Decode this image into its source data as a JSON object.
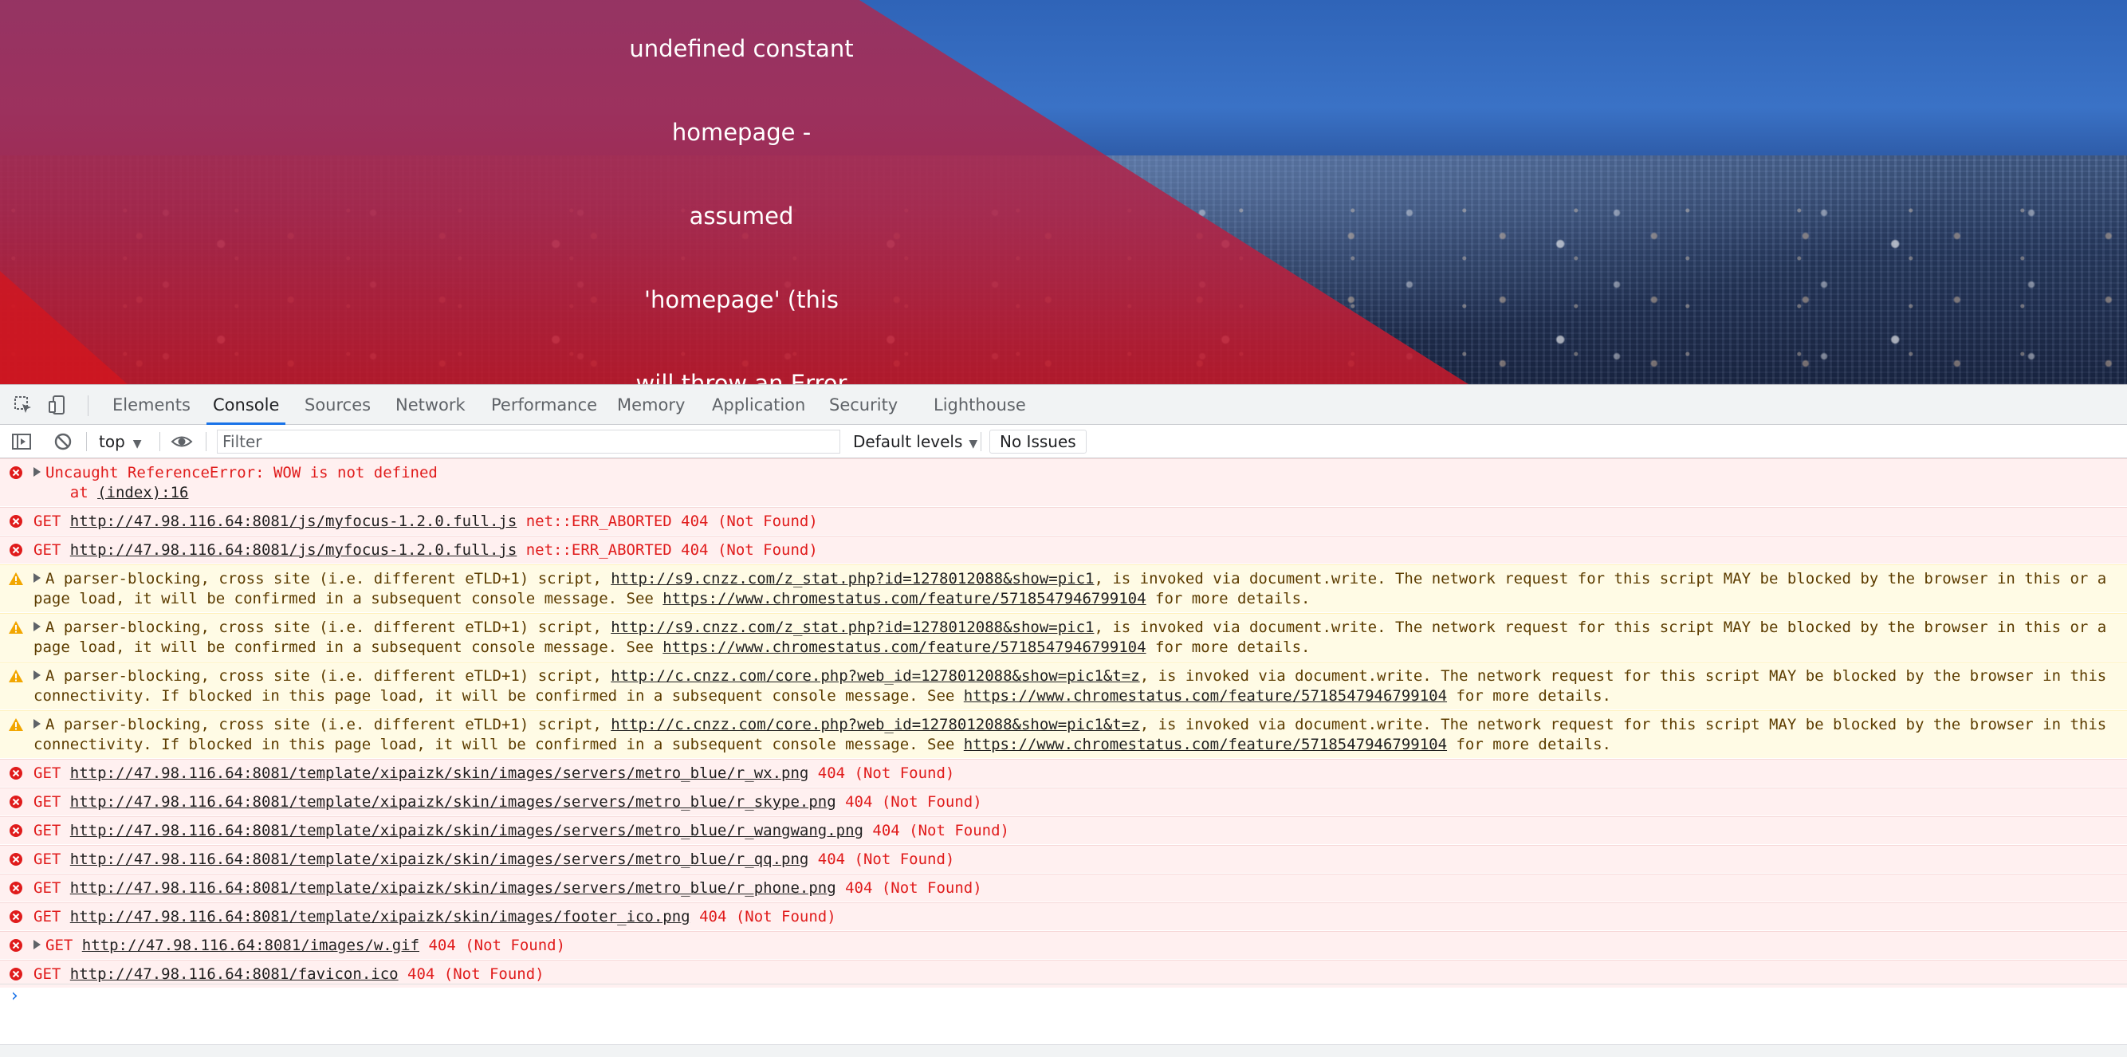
{
  "page": {
    "heading_lines": [
      "undefined constant",
      "homepage -",
      "assumed",
      "'homepage' (this",
      "will throw an Error"
    ]
  },
  "devtools": {
    "tabs": [
      "Elements",
      "Console",
      "Sources",
      "Network",
      "Performance",
      "Memory",
      "Application",
      "Security",
      "Lighthouse"
    ],
    "active_tab": "Console",
    "toolbar": {
      "context": "top",
      "filter_placeholder": "Filter",
      "levels": "Default levels",
      "issues": "No Issues"
    },
    "icons": {
      "inspect": "inspect-element-icon",
      "device": "device-toolbar-icon",
      "sidebar": "show-sidebar-icon",
      "clear": "clear-console-icon",
      "eye": "live-expression-icon",
      "error": "error-icon",
      "warning": "warning-icon",
      "prompt": "chevron-right-icon"
    },
    "colors": {
      "error_text": "#e01b1b",
      "error_bg": "#fff0f0",
      "warning_bg": "#fffbe5",
      "accent": "#1a73e8"
    },
    "messages": [
      {
        "level": "error",
        "expand": true,
        "lines": [
          [
            {
              "t": "Uncaught ReferenceError: WOW is not defined"
            }
          ],
          [
            {
              "t": "    at "
            },
            {
              "t": "(index):16",
              "link": true
            }
          ]
        ]
      },
      {
        "level": "error",
        "lines": [
          [
            {
              "t": "GET "
            },
            {
              "t": "http://47.98.116.64:8081/js/myfocus-1.2.0.full.js",
              "link": true
            },
            {
              "t": " net::ERR_ABORTED 404 (Not Found)"
            }
          ]
        ]
      },
      {
        "level": "error",
        "lines": [
          [
            {
              "t": "GET "
            },
            {
              "t": "http://47.98.116.64:8081/js/myfocus-1.2.0.full.js",
              "link": true
            },
            {
              "t": " net::ERR_ABORTED 404 (Not Found)"
            }
          ]
        ]
      },
      {
        "level": "warning",
        "expand": true,
        "lines": [
          [
            {
              "t": "A parser-blocking, cross site (i.e. different eTLD+1) script, "
            },
            {
              "t": "http://s9.cnzz.com/z_stat.php?id=1278012088&show=pic1",
              "link": true
            },
            {
              "t": ", is invoked via document.write. The network request for this script MAY be blocked by the browser in this or a"
            }
          ],
          [
            {
              "t": "page load, it will be confirmed in a subsequent console message. See "
            },
            {
              "t": "https://www.chromestatus.com/feature/5718547946799104",
              "link": true
            },
            {
              "t": " for more details."
            }
          ]
        ]
      },
      {
        "level": "warning",
        "expand": true,
        "lines": [
          [
            {
              "t": "A parser-blocking, cross site (i.e. different eTLD+1) script, "
            },
            {
              "t": "http://s9.cnzz.com/z_stat.php?id=1278012088&show=pic1",
              "link": true
            },
            {
              "t": ", is invoked via document.write. The network request for this script MAY be blocked by the browser in this or a"
            }
          ],
          [
            {
              "t": "page load, it will be confirmed in a subsequent console message. See "
            },
            {
              "t": "https://www.chromestatus.com/feature/5718547946799104",
              "link": true
            },
            {
              "t": " for more details."
            }
          ]
        ]
      },
      {
        "level": "warning",
        "expand": true,
        "lines": [
          [
            {
              "t": "A parser-blocking, cross site (i.e. different eTLD+1) script, "
            },
            {
              "t": "http://c.cnzz.com/core.php?web_id=1278012088&show=pic1&t=z",
              "link": true
            },
            {
              "t": ", is invoked via document.write. The network request for this script MAY be blocked by the browser in this"
            }
          ],
          [
            {
              "t": "connectivity. If blocked in this page load, it will be confirmed in a subsequent console message. See "
            },
            {
              "t": "https://www.chromestatus.com/feature/5718547946799104",
              "link": true
            },
            {
              "t": " for more details."
            }
          ]
        ]
      },
      {
        "level": "warning",
        "expand": true,
        "lines": [
          [
            {
              "t": "A parser-blocking, cross site (i.e. different eTLD+1) script, "
            },
            {
              "t": "http://c.cnzz.com/core.php?web_id=1278012088&show=pic1&t=z",
              "link": true
            },
            {
              "t": ", is invoked via document.write. The network request for this script MAY be blocked by the browser in this"
            }
          ],
          [
            {
              "t": "connectivity. If blocked in this page load, it will be confirmed in a subsequent console message. See "
            },
            {
              "t": "https://www.chromestatus.com/feature/5718547946799104",
              "link": true
            },
            {
              "t": " for more details."
            }
          ]
        ]
      },
      {
        "level": "error",
        "lines": [
          [
            {
              "t": "GET "
            },
            {
              "t": "http://47.98.116.64:8081/template/xipaizk/skin/images/servers/metro_blue/r_wx.png",
              "link": true
            },
            {
              "t": " 404 (Not Found)"
            }
          ]
        ]
      },
      {
        "level": "error",
        "lines": [
          [
            {
              "t": "GET "
            },
            {
              "t": "http://47.98.116.64:8081/template/xipaizk/skin/images/servers/metro_blue/r_skype.png",
              "link": true
            },
            {
              "t": " 404 (Not Found)"
            }
          ]
        ]
      },
      {
        "level": "error",
        "lines": [
          [
            {
              "t": "GET "
            },
            {
              "t": "http://47.98.116.64:8081/template/xipaizk/skin/images/servers/metro_blue/r_wangwang.png",
              "link": true
            },
            {
              "t": " 404 (Not Found)"
            }
          ]
        ]
      },
      {
        "level": "error",
        "lines": [
          [
            {
              "t": "GET "
            },
            {
              "t": "http://47.98.116.64:8081/template/xipaizk/skin/images/servers/metro_blue/r_qq.png",
              "link": true
            },
            {
              "t": " 404 (Not Found)"
            }
          ]
        ]
      },
      {
        "level": "error",
        "lines": [
          [
            {
              "t": "GET "
            },
            {
              "t": "http://47.98.116.64:8081/template/xipaizk/skin/images/servers/metro_blue/r_phone.png",
              "link": true
            },
            {
              "t": " 404 (Not Found)"
            }
          ]
        ]
      },
      {
        "level": "error",
        "lines": [
          [
            {
              "t": "GET "
            },
            {
              "t": "http://47.98.116.64:8081/template/xipaizk/skin/images/footer_ico.png",
              "link": true
            },
            {
              "t": " 404 (Not Found)"
            }
          ]
        ]
      },
      {
        "level": "error",
        "expand": true,
        "lines": [
          [
            {
              "t": "GET "
            },
            {
              "t": "http://47.98.116.64:8081/images/w.gif",
              "link": true
            },
            {
              "t": " 404 (Not Found)"
            }
          ]
        ]
      },
      {
        "level": "error",
        "lines": [
          [
            {
              "t": "GET "
            },
            {
              "t": "http://47.98.116.64:8081/favicon.ico",
              "link": true
            },
            {
              "t": " 404 (Not Found)"
            }
          ]
        ]
      }
    ]
  }
}
